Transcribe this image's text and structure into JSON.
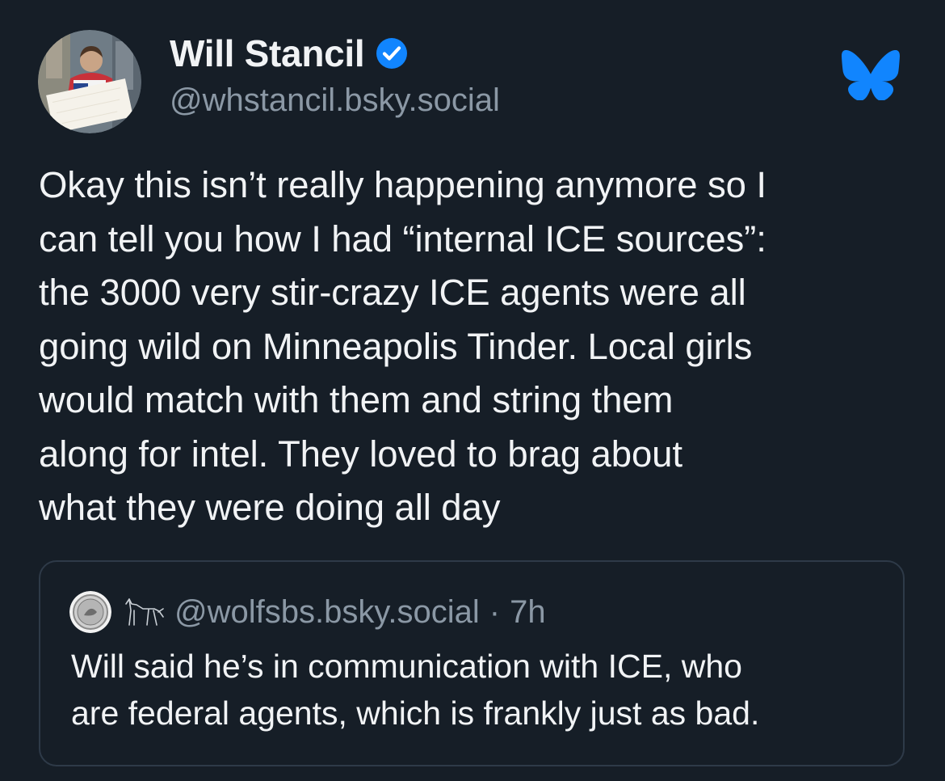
{
  "post": {
    "author": {
      "display_name": "Will Stancil",
      "handle": "@whstancil.bsky.social",
      "verified": true,
      "avatar_sign_text": "There are more of us than them"
    },
    "text": "Okay this isn’t really happening anymore so I\ncan tell you how I had “internal ICE sources”:\nthe 3000 very stir-crazy ICE agents were all\ngoing wild on Minneapolis Tinder. Local girls\nwould match with them and string them\nalong for intel. They loved to brag about\nwhat they were doing all day",
    "quote": {
      "handle": "@wolfsbs.bsky.social",
      "separator": "·",
      "time": "7h",
      "text": "Will said he’s in communication with ICE, who\nare federal agents, which is frankly just as bad."
    }
  },
  "icons": {
    "verified": "verified-check-icon",
    "logo": "bluesky-butterfly-icon",
    "quote_badge": "wolf-icon"
  },
  "colors": {
    "background": "#161e27",
    "text_primary": "#f1f3f5",
    "text_secondary": "#8b98a5",
    "verified_blue": "#1185fe",
    "bluesky_blue": "#1185fe",
    "card_border": "#2e3a48"
  }
}
